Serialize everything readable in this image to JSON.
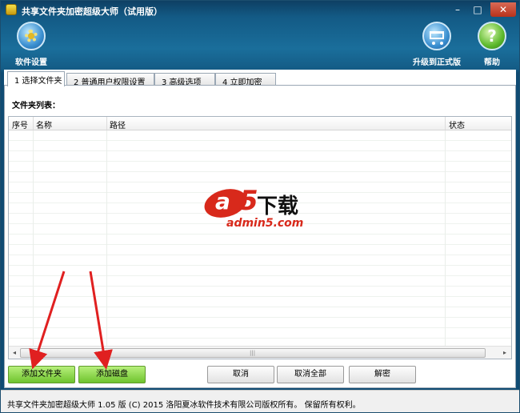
{
  "window": {
    "title": "共享文件夹加密超级大师（试用版）",
    "min": "–",
    "max": "□",
    "close": "✕"
  },
  "toolbar": {
    "settings_label": "软件设置",
    "upgrade_label": "升级到正式版",
    "help_label": "帮助",
    "icons": {
      "settings": "gear-icon",
      "upgrade": "cart-icon",
      "help": "help-icon"
    }
  },
  "tabs": [
    {
      "label": "1 选择文件夹",
      "active": true
    },
    {
      "label": "2 普通用户权限设置",
      "active": false
    },
    {
      "label": "3 高级选项",
      "active": false
    },
    {
      "label": "4 立即加密",
      "active": false
    }
  ],
  "folder_list": {
    "label": "文件夹列表：",
    "columns": [
      "序号",
      "名称",
      "路径",
      "状态"
    ],
    "rows": []
  },
  "scrollbar": {
    "left": "◂",
    "right": "▸",
    "grip": "|||"
  },
  "buttons": {
    "add_folder": "添加文件夹",
    "add_disk": "添加磁盘",
    "cancel": "取消",
    "cancel_all": "取消全部",
    "decrypt": "解密"
  },
  "status": {
    "text": "共享文件夹加密超级大师 1.05 版 (C) 2015 洛阳夏冰软件技术有限公司版权所有。 保留所有权利。"
  },
  "watermark": {
    "a": "a",
    "five": "5",
    "xiazai": "下载",
    "url": "admin5.com"
  },
  "colors": {
    "accent": "#1a6e9b",
    "green_button": "#8bd84a",
    "arrow_red": "#e02020"
  }
}
